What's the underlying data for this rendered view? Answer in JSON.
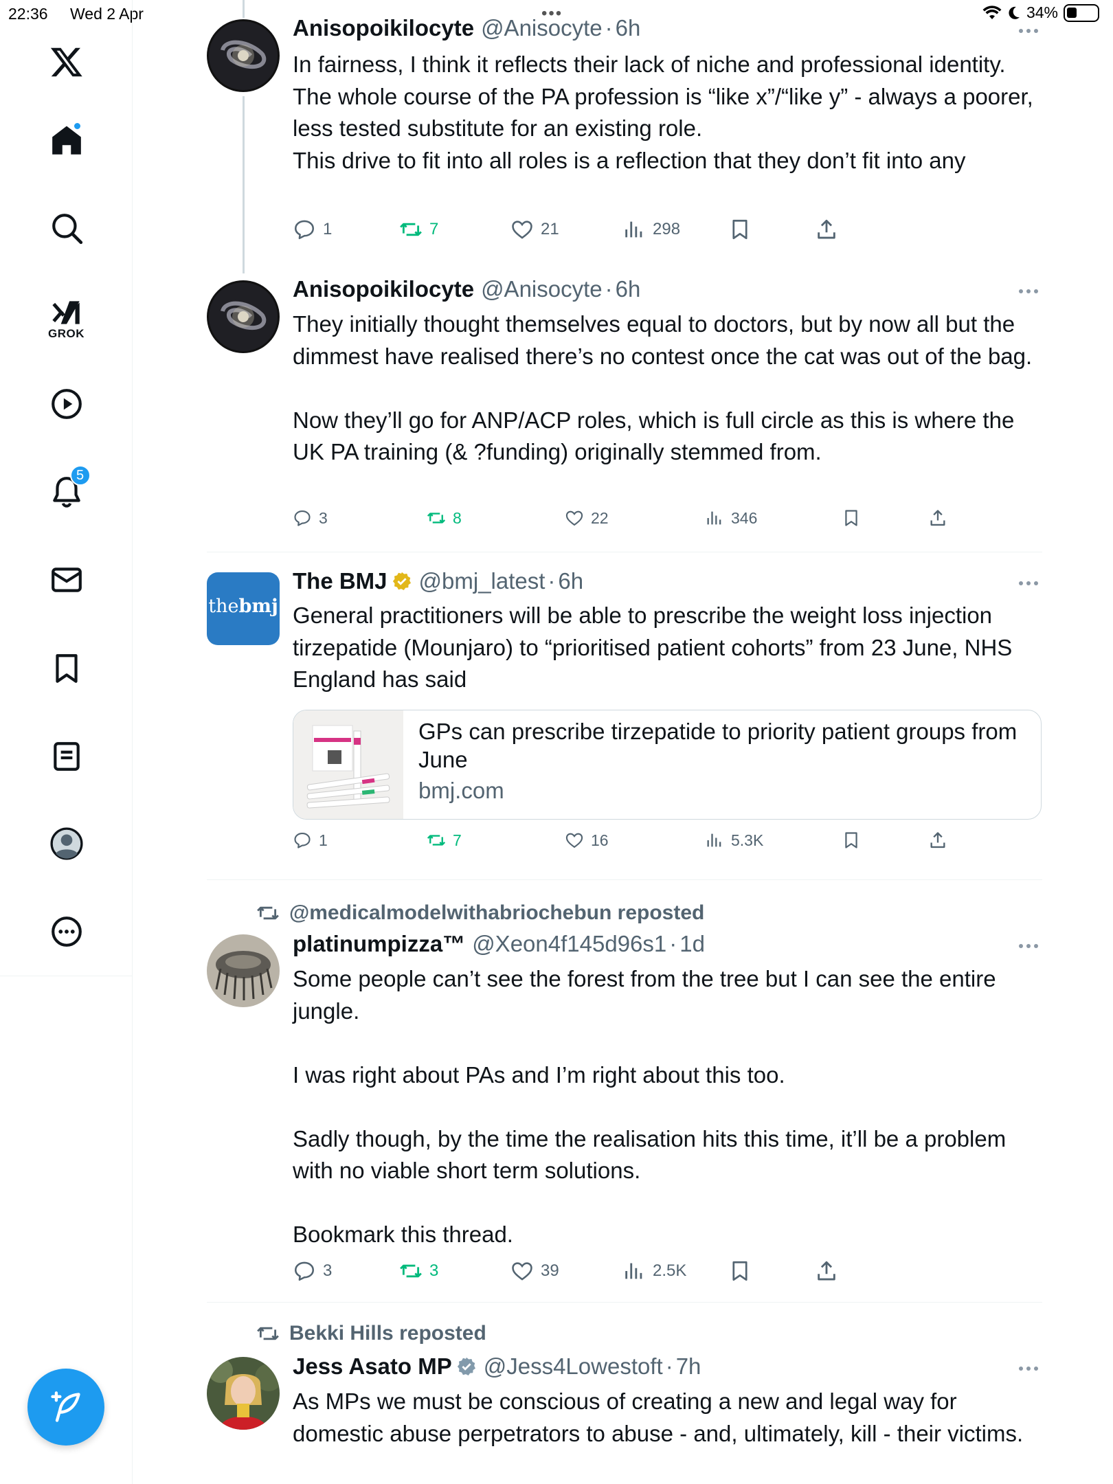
{
  "status_bar": {
    "time": "22:36",
    "date": "Wed 2 Apr",
    "battery_percent": "34%",
    "battery_level": 0.34
  },
  "sidebar": {
    "grok_label": "GROK",
    "notifications_badge": "5",
    "items": [
      {
        "name": "home-icon"
      },
      {
        "name": "search-icon"
      },
      {
        "name": "grok-icon"
      },
      {
        "name": "video-icon"
      },
      {
        "name": "notifications-icon"
      },
      {
        "name": "messages-icon"
      },
      {
        "name": "bookmarks-icon"
      },
      {
        "name": "lists-icon"
      },
      {
        "name": "profile-icon"
      },
      {
        "name": "more-icon"
      }
    ]
  },
  "posts": [
    {
      "name": "Anisopoikilocyte",
      "handle": "@Anisocyte",
      "sep": "·",
      "time": "6h",
      "text": "In fairness, I think it reflects their lack of niche and professional identity.\nThe whole course of the PA profession is “like x”/“like y” - always a poorer, less tested substitute for an existing role.\nThis drive to fit into all roles is a reflection that they don’t fit into any",
      "replies": "1",
      "reposts": "7",
      "likes": "21",
      "views": "298"
    },
    {
      "name": "Anisopoikilocyte",
      "handle": "@Anisocyte",
      "sep": "·",
      "time": "6h",
      "text": "They initially thought themselves equal to doctors, but by now all but the dimmest have realised there’s no contest once the cat was out of the bag.\n\nNow they’ll go for ANP/ACP roles, which is full circle as this is where the UK PA training (& ?funding) originally stemmed from.",
      "replies": "3",
      "reposts": "8",
      "likes": "22",
      "views": "346"
    },
    {
      "name": "The BMJ",
      "handle": "@bmj_latest",
      "sep": "·",
      "time": "6h",
      "avatar_text_1": "the",
      "avatar_text_2": "bmj",
      "text": "General practitioners will be able to prescribe the weight loss injection tirzepatide (Mounjaro) to “prioritised patient cohorts” from 23 June, NHS England has said",
      "card_title": "GPs can prescribe tirzepatide to priority patient groups from June",
      "card_domain": "bmj.com",
      "replies": "1",
      "reposts": "7",
      "likes": "16",
      "views": "5.3K"
    },
    {
      "repost_by": "@medicalmodelwithabriochebun reposted",
      "name": "platinumpizza™",
      "handle": "@Xeon4f145d96s1",
      "sep": "·",
      "time": "1d",
      "text": "Some people can’t see the forest from the tree but I can see the entire jungle.\n\nI was right about PAs and I’m right about this too.\n\nSadly though, by the time the realisation hits this time, it’ll be a problem with no viable short term solutions.\n\nBookmark this thread.",
      "replies": "3",
      "reposts": "3",
      "likes": "39",
      "views": "2.5K"
    },
    {
      "repost_by": "Bekki Hills reposted",
      "name": "Jess Asato MP",
      "handle": "@Jess4Lowestoft",
      "sep": "·",
      "time": "7h",
      "text": "As MPs we must be conscious of creating a new and legal way for domestic abuse perpetrators to abuse - and, ultimately, kill - their victims."
    }
  ],
  "colors": {
    "accent": "#1d9bf0",
    "repost_green": "#00ba7c",
    "secondary_text": "#536471",
    "gold_verified": "#e2b719",
    "bmj_blue": "#2a7bc4"
  }
}
